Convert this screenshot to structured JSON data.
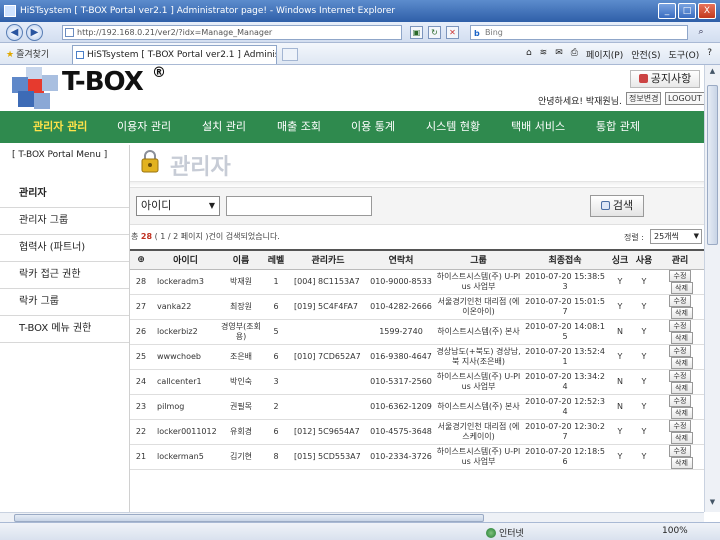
{
  "window": {
    "title": "HiSTsystem [ T-BOX Portal ver2.1 ] Administrator page! - Windows Internet Explorer",
    "minimize": "_",
    "maximize": "□",
    "close": "X"
  },
  "browser": {
    "url": "http://192.168.0.21/ver2/?idx=Manage_Manager",
    "search_placeholder": "Bing",
    "favorites_label": "즐겨찾기",
    "tab_title": "HiSTsystem [ T-BOX Portal ver2.1 ] Adminis...",
    "commands": [
      "페이지(P)",
      "안전(S)",
      "도구(O)",
      "?"
    ],
    "status_zone": "인터넷",
    "zoom": "100%"
  },
  "header": {
    "logo_text": "T-BOX",
    "logo_mark": "®",
    "notice_button": "공지사항",
    "welcome": "안녕하세요! 박재원님.",
    "edit_info": "정보변경",
    "logout": "LOGOUT"
  },
  "nav": {
    "items": [
      "관리자 관리",
      "이용자 관리",
      "설치 관리",
      "매출 조회",
      "이용 통계",
      "시스템 현황",
      "택배 서비스",
      "통합 관제"
    ]
  },
  "sidebar": {
    "heading": "[ T-BOX Portal Menu ]",
    "items": [
      "관리자",
      "관리자 그룹",
      "협력사 (파트너)",
      "락카 접근 권한",
      "락카 그룹",
      "T-BOX 메뉴 권한"
    ]
  },
  "main": {
    "title": "관리자",
    "search": {
      "field_selected": "아이디",
      "keyword": "",
      "button": "검색"
    },
    "summary": {
      "prefix": "총",
      "count": "28",
      "rest": "( 1 / 2 페이지 )건이 검색되었습니다."
    },
    "sort": {
      "label": "정렬 :",
      "value": "25개씩"
    },
    "table": {
      "headers": [
        "⊕",
        "아이디",
        "이름",
        "레벨",
        "관리카드",
        "연락처",
        "그룹",
        "최종접속",
        "싱크",
        "사용",
        "관리"
      ],
      "edit_label": "수정",
      "delete_label": "삭제",
      "rows": [
        {
          "no": "28",
          "id": "lockeradm3",
          "name": "박재원",
          "level": "1",
          "card": "[004] 8C1153A7",
          "phone": "010-9000-8533",
          "group": "하이스트시스템(주) U-Plus 사업부",
          "last": "2010-07-20 15:38:53",
          "sync": "Y",
          "use": "Y"
        },
        {
          "no": "27",
          "id": "vanka22",
          "name": "최장원",
          "level": "6",
          "card": "[019] 5C4F4FA7",
          "phone": "010-4282-2666",
          "group": "서울경기인천 대리점 (에이온아이)",
          "last": "2010-07-20 15:01:57",
          "sync": "Y",
          "use": "Y"
        },
        {
          "no": "26",
          "id": "lockerbiz2",
          "name": "경영부(조회용)",
          "level": "5",
          "card": "",
          "phone": "1599-2740",
          "group": "하이스트시스템(주) 본사",
          "last": "2010-07-20 14:08:15",
          "sync": "N",
          "use": "Y"
        },
        {
          "no": "25",
          "id": "wwwchoeb",
          "name": "조은배",
          "level": "6",
          "card": "[010] 7CD652A7",
          "phone": "016-9380-4647",
          "group": "경상남도(+북도) 경상남,북 지사(조은배)",
          "last": "2010-07-20 13:52:41",
          "sync": "Y",
          "use": "Y"
        },
        {
          "no": "24",
          "id": "callcenter1",
          "name": "박인숙",
          "level": "3",
          "card": "",
          "phone": "010-5317-2560",
          "group": "하이스트시스템(주) U-Plus 사업부",
          "last": "2010-07-20 13:34:24",
          "sync": "N",
          "use": "Y"
        },
        {
          "no": "23",
          "id": "pilmog",
          "name": "권필목",
          "level": "2",
          "card": "",
          "phone": "010-6362-1209",
          "group": "하이스트시스템(주) 본사",
          "last": "2010-07-20 12:52:34",
          "sync": "N",
          "use": "Y"
        },
        {
          "no": "22",
          "id": "locker0011012",
          "name": "유회경",
          "level": "6",
          "card": "[012] 5C9654A7",
          "phone": "010-4575-3648",
          "group": "서울경기인천 대리점 (에스케이이)",
          "last": "2010-07-20 12:30:27",
          "sync": "Y",
          "use": "Y"
        },
        {
          "no": "21",
          "id": "lockerman5",
          "name": "김기현",
          "level": "8",
          "card": "[015] 5CD553A7",
          "phone": "010-2334-3726",
          "group": "하이스트시스템(주) U-Plus 사업부",
          "last": "2010-07-20 12:18:56",
          "sync": "Y",
          "use": "Y"
        }
      ]
    }
  },
  "colors": {
    "nav_green": "#2f8a4e",
    "nav_active": "#ffe24a",
    "count_red": "#c03020",
    "title_gray": "#c7ccd6"
  }
}
